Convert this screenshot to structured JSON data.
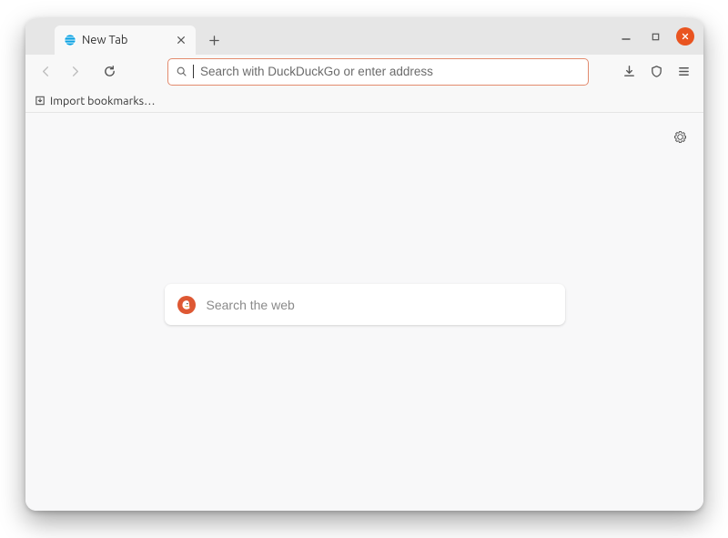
{
  "tab": {
    "title": "New Tab"
  },
  "addressbar": {
    "placeholder": "Search with DuckDuckGo or enter address",
    "value": ""
  },
  "bookmarks": {
    "import_label": "Import bookmarks…"
  },
  "newtab_page": {
    "search_placeholder": "Search the web",
    "search_value": ""
  },
  "icons": {
    "favicon": "firefox-globe-icon",
    "close": "close-icon",
    "newtab": "plus-icon",
    "minimize": "minimize-icon",
    "maximize": "maximize-icon",
    "window_close": "window-close-icon",
    "back": "back-icon",
    "forward": "forward-icon",
    "reload": "reload-icon",
    "search": "search-icon",
    "downloads": "downloads-icon",
    "shield": "shield-icon",
    "hamburger": "hamburger-icon",
    "import": "import-icon",
    "gear": "gear-icon",
    "ddg": "duckduckgo-logo"
  },
  "colors": {
    "accent_orange": "#e95420",
    "addrbar_border": "#e38b6e",
    "tabbar_bg": "#e6e6e6",
    "chrome_bg": "#f8f8f8",
    "content_bg": "#f8f8f9",
    "ddg_orange": "#de5833"
  }
}
